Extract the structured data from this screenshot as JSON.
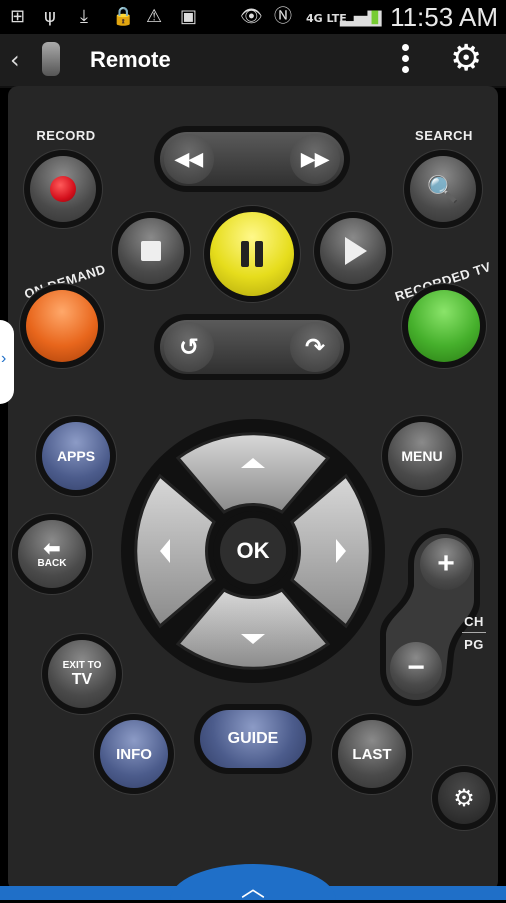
{
  "status_bar": {
    "time": "11:53 AM",
    "network": "4G LTE"
  },
  "action_bar": {
    "title": "Remote"
  },
  "buttons": {
    "record": "RECORD",
    "search": "SEARCH",
    "on_demand": "ON DEMAND",
    "recorded_tv": "RECORDED TV",
    "apps": "APPS",
    "menu": "MENU",
    "ok": "OK",
    "back": "BACK",
    "exit_to": "EXIT TO",
    "tv": "TV",
    "info": "INFO",
    "guide": "GUIDE",
    "last": "LAST",
    "ch": "CH",
    "pg": "PG"
  },
  "colors": {
    "accent_blue": "#1f6fc8",
    "record_red": "#d4101c",
    "pause_yellow": "#e6dd1c",
    "on_demand_orange": "#e8661c",
    "recorded_tv_green": "#46b02c"
  }
}
